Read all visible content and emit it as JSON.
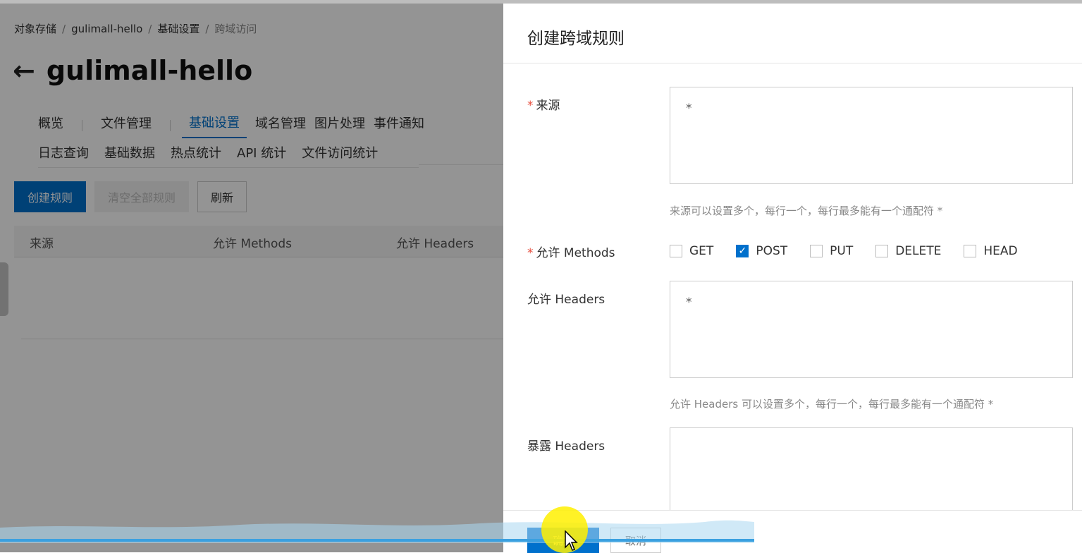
{
  "breadcrumb": {
    "item1": "对象存储",
    "sep": "/",
    "item2": "gulimall-hello",
    "item3": "基础设置",
    "item4": "跨域访问"
  },
  "header": {
    "back_icon": "left-arrow-icon",
    "title": "gulimall-hello"
  },
  "tabs_row1": [
    "概览",
    "文件管理",
    "基础设置",
    "域名管理",
    "图片处理",
    "事件通知"
  ],
  "tabs_row2": [
    "日志查询",
    "基础数据",
    "热点统计",
    "API 统计",
    "文件访问统计"
  ],
  "actions": {
    "create": "创建规则",
    "clear": "清空全部规则",
    "refresh": "刷新"
  },
  "table": {
    "columns": [
      "来源",
      "允许 Methods",
      "允许 Headers"
    ]
  },
  "drawer": {
    "title": "创建跨域规则",
    "origin_label": "来源",
    "required_mark": "*",
    "origin_value": "*",
    "origin_hint": "来源可以设置多个，每行一个，每行最多能有一个通配符 *",
    "methods_label": "允许 Methods",
    "methods": [
      {
        "label": "GET",
        "checked": false
      },
      {
        "label": "POST",
        "checked": true
      },
      {
        "label": "PUT",
        "checked": false
      },
      {
        "label": "DELETE",
        "checked": false
      },
      {
        "label": "HEAD",
        "checked": false
      }
    ],
    "allow_headers_label": "允许 Headers",
    "allow_headers_value": "*",
    "allow_headers_hint": "允许 Headers 可以设置多个，每行一个，每行最多能有一个通配符 *",
    "expose_headers_label": "暴露 Headers",
    "expose_headers_value": "",
    "ok": "确定",
    "cancel": "取消"
  },
  "colors": {
    "primary": "#0070cc",
    "required": "#e64c3c",
    "overlay": "rgba(0,0,0,0.42)"
  }
}
